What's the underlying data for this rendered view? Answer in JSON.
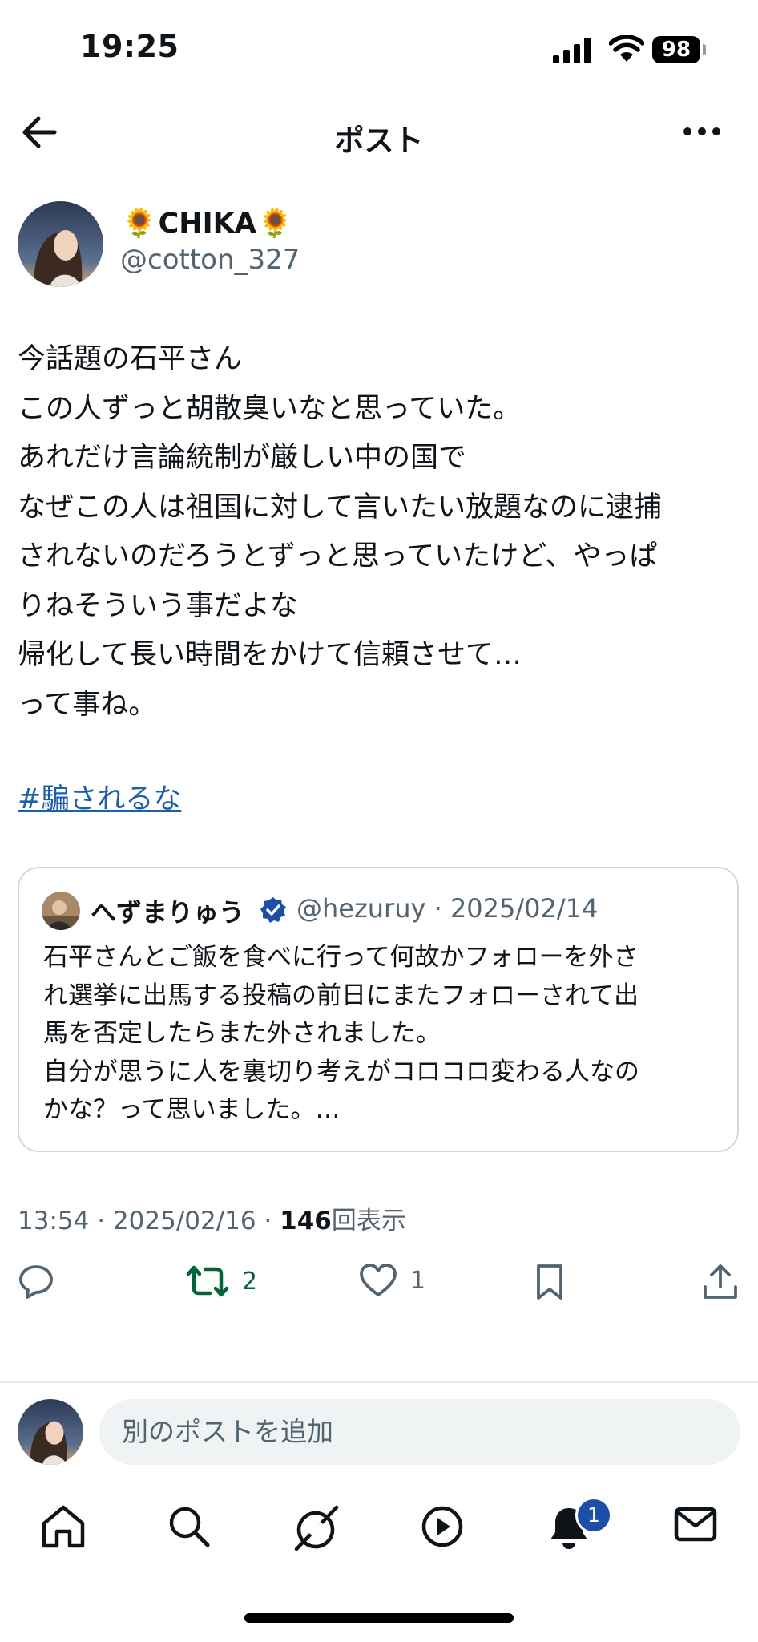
{
  "status_bar": {
    "time": "19:25",
    "battery": "98"
  },
  "header": {
    "title": "ポスト"
  },
  "post": {
    "author_name": "CHIKA",
    "author_emoji": "🌻",
    "author_handle": "@cotton_327",
    "body_lines": [
      "今話題の石平さん",
      "この人ずっと胡散臭いなと思っていた。",
      "あれだけ言論統制が厳しい中の国で",
      "なぜこの人は祖国に対して言いたい放題なのに逮捕",
      "されないのだろうとずっと思っていたけど、やっぱ",
      "りねそういう事だよな",
      "帰化して長い時間をかけて信頼させて…",
      "って事ね。"
    ],
    "hashtag": "#騙されるな"
  },
  "quote": {
    "name": "へずまりゅう",
    "handle_date": "@hezuruy · 2025/02/14",
    "body_lines": [
      "石平さんとご飯を食べに行って何故かフォローを外さ",
      "れ選挙に出馬する投稿の前日にまたフォローされて出",
      "馬を否定したらまた外されました。",
      "自分が思うに人を裏切り考えがコロコロ変わる人なの",
      "かな？って思いました。…"
    ]
  },
  "meta": {
    "timestamp": "13:54 · 2025/02/16 · ",
    "views_count": "146",
    "views_label": "回表示"
  },
  "actions": {
    "retweets": "2",
    "likes": "1"
  },
  "reply": {
    "placeholder": "別のポストを追加"
  },
  "tabbar": {
    "notifications_badge": "1"
  },
  "colors": {
    "accent": "#1d5fa8",
    "retweet_green": "#00663a",
    "verified": "#1d4fa8",
    "muted": "#536471"
  }
}
